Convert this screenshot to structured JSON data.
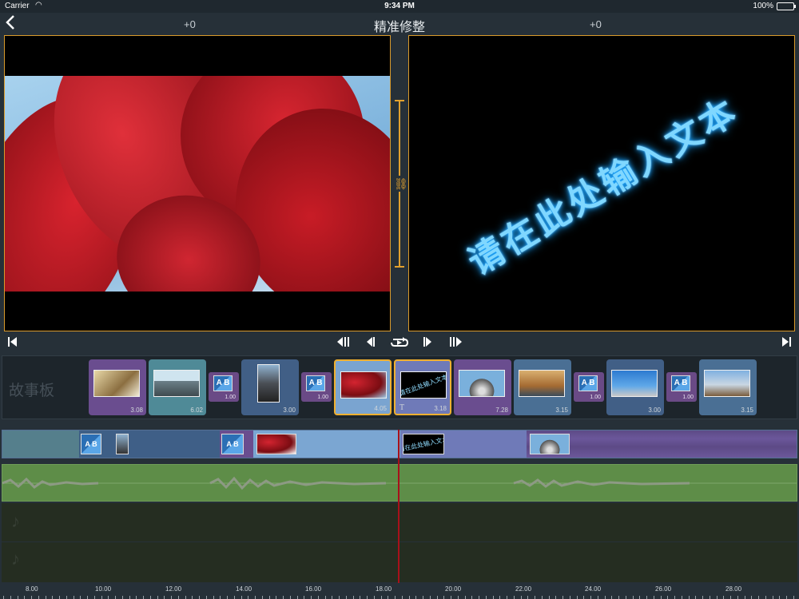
{
  "status_bar": {
    "carrier": "Carrier",
    "time": "9:34 PM",
    "battery": "100%"
  },
  "header": {
    "title": "精准修整",
    "left_offset": "+0",
    "right_offset": "+0"
  },
  "preview": {
    "overlay_text": "请在此处输入文本"
  },
  "storyboard": {
    "label": "故事板",
    "items": [
      {
        "kind": "clip",
        "duration": "3.08"
      },
      {
        "kind": "clip",
        "duration": "6.02"
      },
      {
        "kind": "transition",
        "label": "A B",
        "duration": "1.00"
      },
      {
        "kind": "clip",
        "duration": "3.00"
      },
      {
        "kind": "transition",
        "label": "A B",
        "duration": "1.00"
      },
      {
        "kind": "clip",
        "duration": "4.05"
      },
      {
        "kind": "clip",
        "duration": "3.18",
        "title_text": "请在此处输入文本",
        "title_icon": "T"
      },
      {
        "kind": "clip",
        "duration": "7.28"
      },
      {
        "kind": "clip",
        "duration": "3.15"
      },
      {
        "kind": "transition",
        "label": "A B",
        "duration": "1.00"
      },
      {
        "kind": "clip",
        "duration": "3.00"
      },
      {
        "kind": "transition",
        "label": "A B",
        "duration": "1.00"
      },
      {
        "kind": "clip",
        "duration": "3.15"
      }
    ]
  },
  "timeline": {
    "title_segment_text": "请在此处输入文本",
    "transition_label": "A B",
    "ruler_labels": [
      "8.00",
      "10.00",
      "12.00",
      "14.00",
      "16.00",
      "18.00",
      "20.00",
      "22.00",
      "24.00",
      "26.00",
      "28.00"
    ]
  },
  "colors": {
    "accent": "#e2a12e",
    "playhead": "#a8101a",
    "audio_track": "#5e8d48",
    "video_track": "#2f4d70",
    "title_glow": "#7fd7ff"
  },
  "icons": [
    "back-icon",
    "skip-to-start-icon",
    "jump-back-icon",
    "step-back-icon",
    "loop-play-icon",
    "step-forward-icon",
    "jump-forward-icon",
    "skip-to-end-icon",
    "link-icon",
    "music-note-icon"
  ]
}
